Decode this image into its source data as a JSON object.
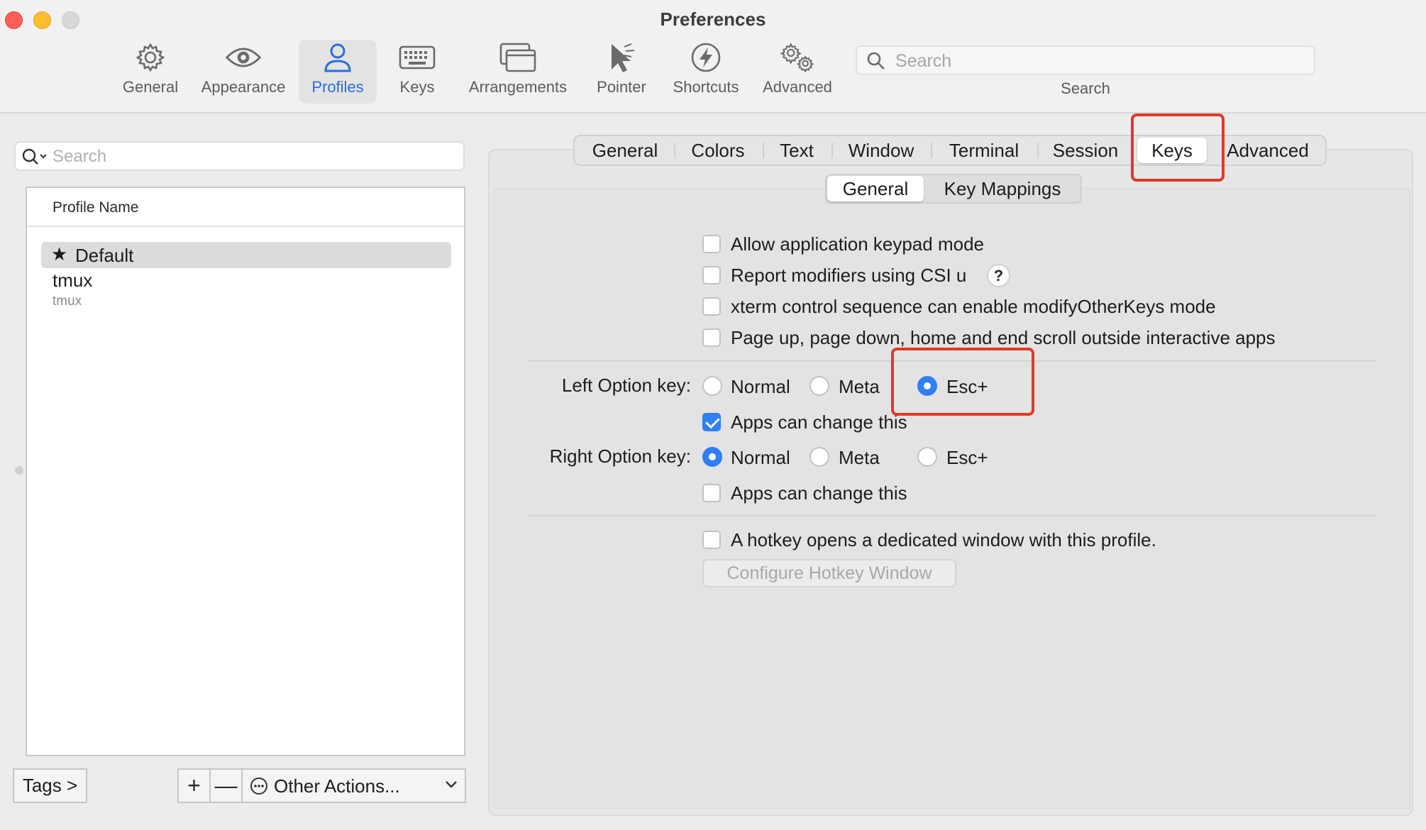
{
  "window": {
    "title": "Preferences"
  },
  "toolbar": {
    "items": [
      {
        "label": "General",
        "icon": "gear-icon"
      },
      {
        "label": "Appearance",
        "icon": "eye-icon"
      },
      {
        "label": "Profiles",
        "icon": "person-icon",
        "active": true
      },
      {
        "label": "Keys",
        "icon": "keyboard-icon"
      },
      {
        "label": "Arrangements",
        "icon": "windows-icon"
      },
      {
        "label": "Pointer",
        "icon": "pointer-icon"
      },
      {
        "label": "Shortcuts",
        "icon": "bolt-icon"
      },
      {
        "label": "Advanced",
        "icon": "gears-icon"
      }
    ],
    "search": {
      "placeholder": "Search",
      "label": "Search"
    }
  },
  "profiles": {
    "search_placeholder": "Search",
    "header": "Profile Name",
    "rows": [
      {
        "name": "Default",
        "starred": true,
        "selected": true
      },
      {
        "name": "tmux",
        "subtitle": "tmux"
      }
    ],
    "tags_button": "Tags >",
    "add_button": "+",
    "remove_button": "—",
    "other_actions": "Other Actions..."
  },
  "tabs": {
    "items": [
      "General",
      "Colors",
      "Text",
      "Window",
      "Terminal",
      "Session",
      "Keys",
      "Advanced"
    ],
    "selected": "Keys"
  },
  "subtabs": {
    "items": [
      "General",
      "Key Mappings"
    ],
    "selected": "General"
  },
  "options": {
    "allow_keypad": {
      "label": "Allow application keypad mode",
      "checked": false
    },
    "report_modifiers": {
      "label": "Report modifiers using CSI u",
      "checked": false,
      "help": "?"
    },
    "xterm_modify": {
      "label": "xterm control sequence can enable modifyOtherKeys mode",
      "checked": false
    },
    "page_scroll": {
      "label": "Page up, page down, home and end scroll outside interactive apps",
      "checked": false
    }
  },
  "left_option": {
    "label": "Left Option key:",
    "choices": [
      "Normal",
      "Meta",
      "Esc+"
    ],
    "selected": "Esc+",
    "apps_can_change": {
      "label": "Apps can change this",
      "checked": true
    }
  },
  "right_option": {
    "label": "Right Option key:",
    "choices": [
      "Normal",
      "Meta",
      "Esc+"
    ],
    "selected": "Normal",
    "apps_can_change": {
      "label": "Apps can change this",
      "checked": false
    }
  },
  "hotkey": {
    "label": "A hotkey opens a dedicated window with this profile.",
    "checked": false,
    "button": "Configure Hotkey Window"
  },
  "colors": {
    "accent": "#2f7ff5",
    "annotation": "#e0392b"
  }
}
